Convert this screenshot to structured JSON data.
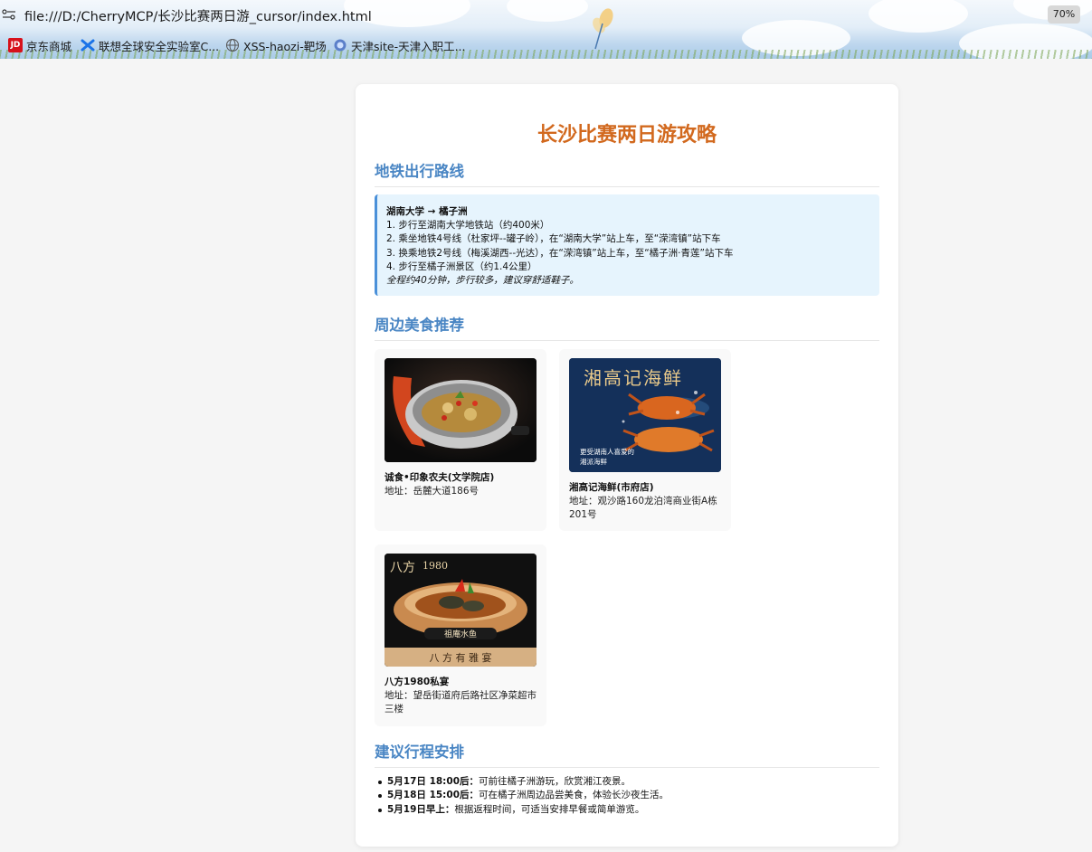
{
  "browser": {
    "url": "file:///D:/CherryMCP/长沙比赛两日游_cursor/index.html",
    "zoom": "70%",
    "bookmarks": [
      {
        "label": "京东商城",
        "icon": "jd-icon"
      },
      {
        "label": "联想全球安全实验室C...",
        "icon": "lenovo-icon"
      },
      {
        "label": "XSS-haozi-靶场",
        "icon": "globe-icon"
      },
      {
        "label": "天津site-天津入职工...",
        "icon": "shield-globe-icon"
      }
    ]
  },
  "page": {
    "title": "长沙比赛两日游攻略",
    "sections": {
      "metro": "地铁出行路线",
      "food": "周边美食推荐",
      "plan": "建议行程安排"
    },
    "route": {
      "heading": "湖南大学 → 橘子洲",
      "steps": [
        "1. 步行至湖南大学地铁站（约400米）",
        "2. 乘坐地铁4号线（杜家坪--罐子岭），在“湖南大学”站上车，至“溁湾镇”站下车",
        "3. 换乘地铁2号线（梅溪湖西--光达），在“溁湾镇”站上车，至“橘子洲·青莲”站下车",
        "4. 步行至橘子洲景区（约1.4公里）"
      ],
      "note": "全程约40分钟，步行较多，建议穿舒适鞋子。"
    },
    "restaurants": [
      {
        "name": "诚食•印象农夫(文学院店)",
        "address": "地址：岳麓大道186号",
        "image": "food-photo-pot"
      },
      {
        "name": "湘高记海鲜(市府店)",
        "address": "地址：观沙路160龙泊湾商业街A栋201号",
        "image": "food-photo-crab",
        "image_text": {
          "brand": "湘高记海鲜",
          "tagline1": "更受湖南人喜爱的",
          "tagline2": "湘派海鲜"
        }
      },
      {
        "name": "八方1980私宴",
        "address": "地址：望岳街道府后路社区净菜超市三楼",
        "image": "food-photo-fish",
        "image_text": {
          "brand": "八方",
          "year": "1980",
          "dish": "祖庵水鱼",
          "banner": "八 方 有 雅 宴"
        }
      }
    ],
    "plan": [
      {
        "time": "5月17日 18:00后：",
        "text": "可前往橘子洲游玩，欣赏湘江夜景。"
      },
      {
        "time": "5月18日 15:00后：",
        "text": "可在橘子洲周边品尝美食，体验长沙夜生活。"
      },
      {
        "time": "5月19日早上：",
        "text": "根据返程时间，可适当安排早餐或简单游览。"
      }
    ]
  }
}
